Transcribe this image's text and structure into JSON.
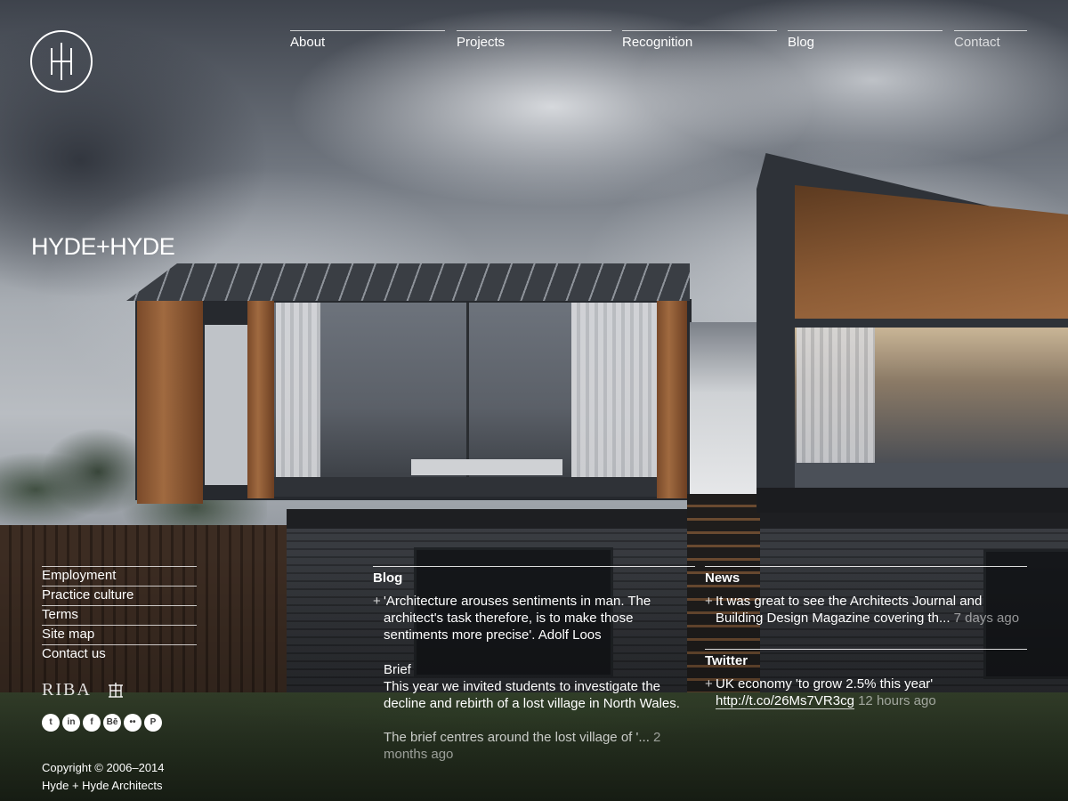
{
  "brand": {
    "wordmark": "HYDE+HYDE",
    "logo_icon": "hyde-monogram-icon"
  },
  "nav": {
    "items": [
      {
        "label": "About"
      },
      {
        "label": "Projects"
      },
      {
        "label": "Recognition"
      },
      {
        "label": "Blog"
      },
      {
        "label": "Contact"
      }
    ]
  },
  "footer": {
    "links": [
      {
        "label": "Employment"
      },
      {
        "label": "Practice culture"
      },
      {
        "label": "Terms"
      },
      {
        "label": "Site map"
      },
      {
        "label": "Contact us"
      }
    ],
    "riba": "RIBA",
    "riba_icon": "riba-crest-icon",
    "social": [
      {
        "name": "twitter",
        "glyph": "t"
      },
      {
        "name": "linkedin",
        "glyph": "in"
      },
      {
        "name": "facebook",
        "glyph": "f"
      },
      {
        "name": "behance",
        "glyph": "Bē"
      },
      {
        "name": "flickr",
        "glyph": "••"
      },
      {
        "name": "pinterest",
        "glyph": "P"
      }
    ],
    "copyright_line1": "Copyright © 2006–2014",
    "copyright_line2": "Hyde + Hyde Architects"
  },
  "blog": {
    "heading": "Blog",
    "plus": "+",
    "quote": "'Architecture arouses sentiments in man. The architect's task therefore, is to make those sentiments more precise'. Adolf Loos",
    "brief_title": "Brief",
    "brief_text": "This year we invited students to investigate the decline and rebirth of a lost village in North Wales.",
    "brief_more": "The brief centres around the lost village of '...",
    "brief_time": "2 months ago"
  },
  "news": {
    "heading": "News",
    "plus": "+",
    "text": "It was great to see the Architects Journal and Building Design Magazine covering th...",
    "time": "7 days ago"
  },
  "twitter": {
    "heading": "Twitter",
    "plus": "+",
    "text": "UK economy 'to grow 2.5% this year'",
    "link": "http://t.co/26Ms7VR3cg",
    "time": "12 hours ago"
  },
  "colors": {
    "text": "#ffffff",
    "muted_text": "rgba(255,255,255,0.55)"
  }
}
